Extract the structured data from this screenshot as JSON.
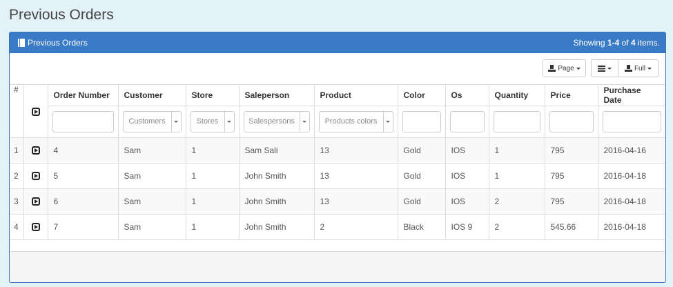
{
  "page": {
    "title": "Previous Orders"
  },
  "panel": {
    "heading": "Previous Orders",
    "summary_prefix": "Showing ",
    "summary_range": "1-4",
    "summary_mid": " of ",
    "summary_total": "4",
    "summary_suffix": " items."
  },
  "toolbar": {
    "page_label": "Page",
    "full_label": "Full",
    "icons": {
      "export": "export-icon",
      "columns": "list-icon"
    }
  },
  "table": {
    "headers": [
      "#",
      "",
      "Order Number",
      "Customer",
      "Store",
      "Saleperson",
      "Product",
      "Color",
      "Os",
      "Quantity",
      "Price",
      "Purchase Date"
    ],
    "filters": {
      "customer": "Customers",
      "store": "Stores",
      "saleperson": "Salespersons",
      "product": "Products colors"
    },
    "rows": [
      {
        "index": "1",
        "order_number": "4",
        "customer": "Sam",
        "store": "1",
        "saleperson": "Sam Sali",
        "product": "13",
        "color": "Gold",
        "os": "IOS",
        "quantity": "1",
        "price": "795",
        "purchase_date": "2016-04-16"
      },
      {
        "index": "2",
        "order_number": "5",
        "customer": "Sam",
        "store": "1",
        "saleperson": "John Smith",
        "product": "13",
        "color": "Gold",
        "os": "IOS",
        "quantity": "1",
        "price": "795",
        "purchase_date": "2016-04-18"
      },
      {
        "index": "3",
        "order_number": "6",
        "customer": "Sam",
        "store": "1",
        "saleperson": "John Smith",
        "product": "13",
        "color": "Gold",
        "os": "IOS",
        "quantity": "2",
        "price": "795",
        "purchase_date": "2016-04-18"
      },
      {
        "index": "4",
        "order_number": "7",
        "customer": "Sam",
        "store": "1",
        "saleperson": "John Smith",
        "product": "2",
        "color": "Black",
        "os": "IOS 9",
        "quantity": "2",
        "price": "545.66",
        "purchase_date": "2016-04-18"
      }
    ]
  },
  "colors": {
    "page_bg": "#e3f1f8",
    "panel_heading": "#3a7bc8",
    "panel_border": "#3a76b5"
  }
}
